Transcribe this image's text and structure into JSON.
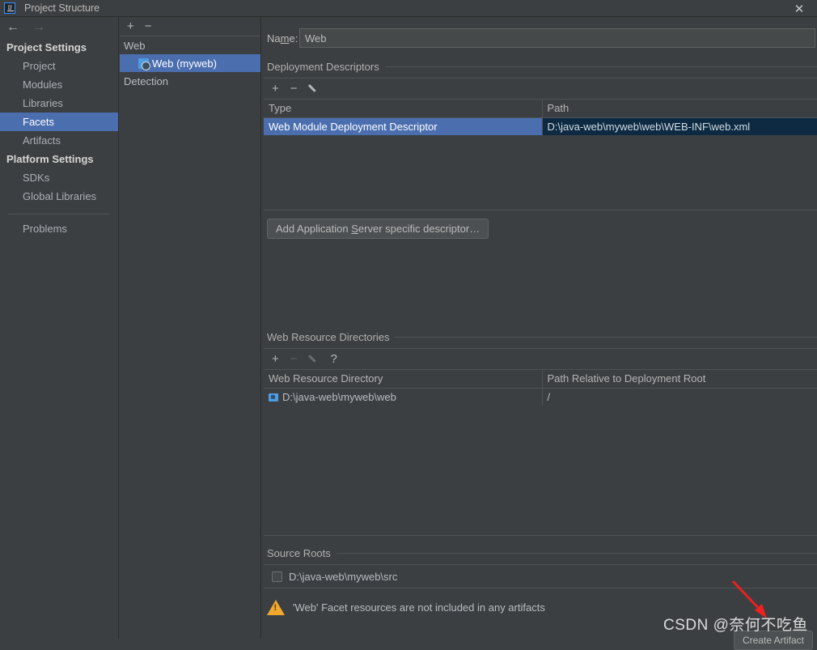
{
  "window": {
    "title": "Project Structure",
    "logo_text": "IJ",
    "close_label": "✕"
  },
  "nav": {
    "back_icon": "←",
    "forward_icon": "→"
  },
  "sidebar": {
    "groups": [
      {
        "title": "Project Settings",
        "items": [
          {
            "label": "Project",
            "selected": false
          },
          {
            "label": "Modules",
            "selected": false
          },
          {
            "label": "Libraries",
            "selected": false
          },
          {
            "label": "Facets",
            "selected": true
          },
          {
            "label": "Artifacts",
            "selected": false
          }
        ]
      },
      {
        "title": "Platform Settings",
        "items": [
          {
            "label": "SDKs",
            "selected": false
          },
          {
            "label": "Global Libraries",
            "selected": false
          }
        ]
      }
    ],
    "problems_label": "Problems"
  },
  "facets": {
    "toolbar": {
      "add": "+",
      "remove": "−"
    },
    "rows": [
      {
        "label": "Web",
        "child": false,
        "selected": false,
        "icon": false
      },
      {
        "label": "Web (myweb)",
        "child": true,
        "selected": true,
        "icon": true
      },
      {
        "label": "Detection",
        "child": false,
        "selected": false,
        "icon": false
      }
    ]
  },
  "main": {
    "name_label_pre": "Na",
    "name_label_mnemonic": "m",
    "name_label_post": "e:",
    "name_value": "Web",
    "name_placeholder": "",
    "deployment": {
      "section_title": "Deployment Descriptors",
      "toolbar": {
        "add": "+",
        "remove": "−",
        "edit": "pencil-icon"
      },
      "columns": [
        "Type",
        "Path"
      ],
      "rows": [
        {
          "type": "Web Module Deployment Descriptor",
          "path": "D:\\java-web\\myweb\\web\\WEB-INF\\web.xml",
          "selected": true
        }
      ],
      "add_descriptor_button": {
        "pre": "Add Application ",
        "mnemonic": "S",
        "post": "erver specific descriptor…"
      }
    },
    "web_resources": {
      "section_title": "Web Resource Directories",
      "toolbar": {
        "add": "+",
        "remove": "−",
        "edit": "pencil-icon",
        "help": "?"
      },
      "columns": [
        "Web Resource Directory",
        "Path Relative to Deployment Root"
      ],
      "rows": [
        {
          "directory": "D:\\java-web\\myweb\\web",
          "relative": "/"
        }
      ]
    },
    "source_roots": {
      "section_title": "Source Roots",
      "rows": [
        {
          "label": "D:\\java-web\\myweb\\src",
          "checked": false
        }
      ]
    },
    "warning": {
      "text": "'Web' Facet resources are not included in any artifacts",
      "icon": "warning-triangle-icon"
    },
    "action_button": "Create Artifact"
  },
  "watermark": {
    "text": "CSDN @奈何不吃鱼"
  },
  "colors": {
    "background": "#3c3f41",
    "selection_blue": "#4b6eaf",
    "selection_dark": "#0d2a42",
    "warning_orange": "#f0a830",
    "accent_icon_blue": "#4d9de0",
    "arrow_red": "#ee2020"
  }
}
